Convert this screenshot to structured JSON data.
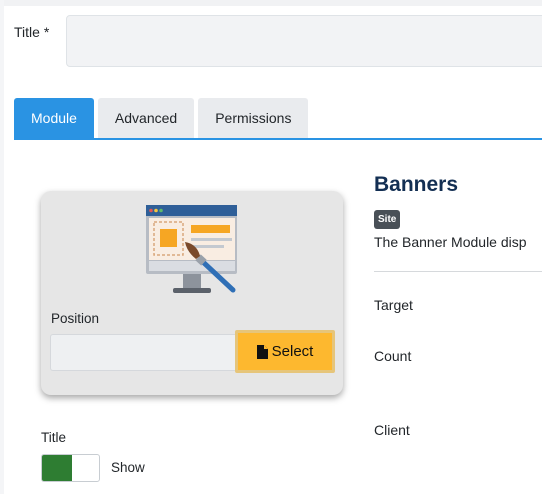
{
  "form": {
    "title_label": "Title *",
    "title_value": ""
  },
  "tabs": [
    {
      "label": "Module",
      "active": true
    },
    {
      "label": "Advanced",
      "active": false
    },
    {
      "label": "Permissions",
      "active": false
    }
  ],
  "position": {
    "label": "Position",
    "value": "",
    "select_label": "Select",
    "select_icon": "file-icon",
    "illustration_icon": "monitor-paintbrush-icon"
  },
  "title_toggle": {
    "label": "Title",
    "state_label": "Show",
    "on": true
  },
  "module_info": {
    "name": "Banners",
    "badge": "Site",
    "description": "The Banner Module disp"
  },
  "fields": {
    "target": "Target",
    "count": "Count",
    "client": "Client"
  },
  "colors": {
    "accent": "#2a93e3",
    "select_button": "#fdb82f",
    "toggle_on": "#2e7d32",
    "heading": "#132f53",
    "badge": "#495057"
  }
}
